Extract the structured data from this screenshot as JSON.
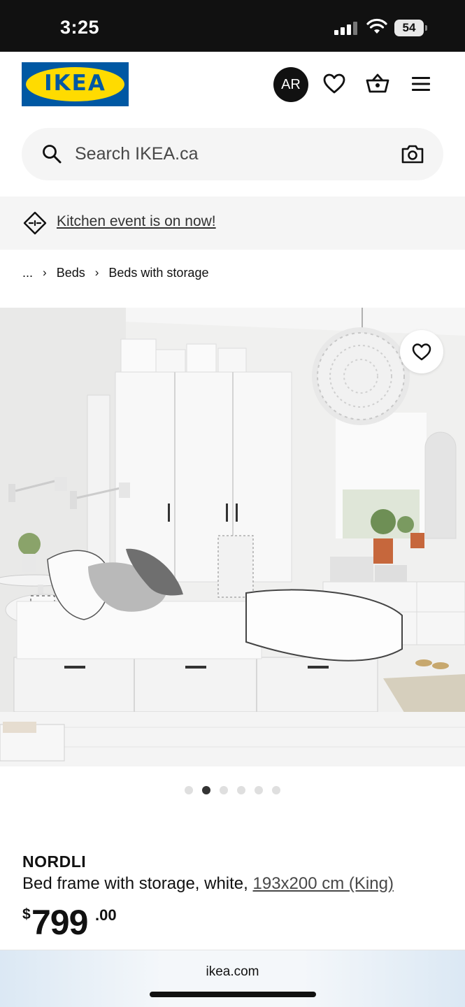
{
  "status_bar": {
    "time": "3:25",
    "battery": "54"
  },
  "header": {
    "logo_text": "IKEA",
    "avatar_initials": "AR"
  },
  "search": {
    "placeholder": "Search IKEA.ca"
  },
  "promo": {
    "text": "Kitchen event is on now!"
  },
  "breadcrumb": {
    "ellipsis": "...",
    "items": [
      "Beds",
      "Beds with storage"
    ]
  },
  "gallery": {
    "image_count": 6,
    "active_index": 1
  },
  "product": {
    "name": "NORDLI",
    "description": "Bed frame with storage, white,",
    "size_link": "193x200 cm (King)",
    "price": {
      "currency": "$",
      "main": "799",
      "decimals": ".00"
    }
  },
  "browser": {
    "url": "ikea.com"
  },
  "colors": {
    "ikea_blue": "#0058a3",
    "ikea_yellow": "#ffdb00",
    "status_bar_bg": "#111111"
  }
}
